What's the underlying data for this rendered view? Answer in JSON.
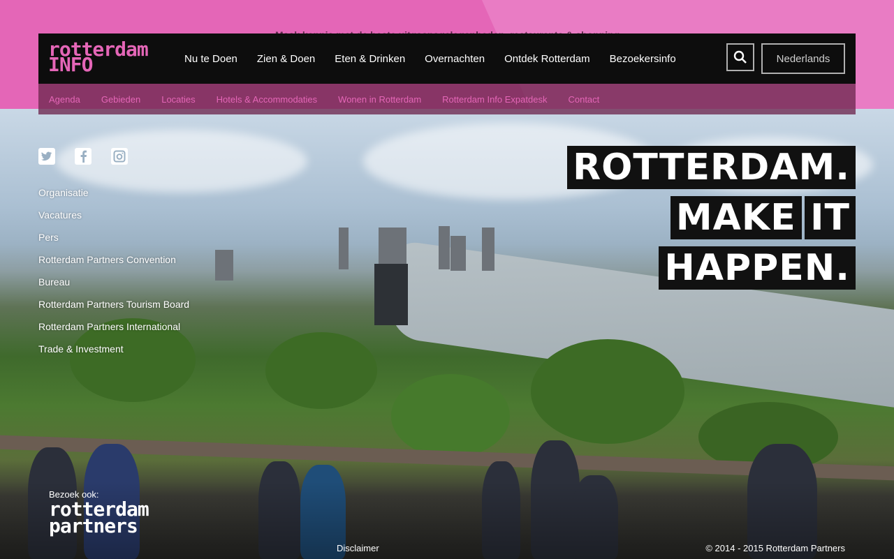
{
  "brand": {
    "line1": "rotterdam",
    "line2": "INFO",
    "color": "#e466b7"
  },
  "ghost_text": "Maak kennis met de beste uitgaansgelegenheden, restaurants & shopping",
  "main_nav": [
    "Nu te Doen",
    "Zien & Doen",
    "Eten & Drinken",
    "Overnachten",
    "Ontdek Rotterdam",
    "Bezoekersinfo"
  ],
  "search": {
    "icon": "search-icon"
  },
  "language": "Nederlands",
  "sub_nav": [
    "Agenda",
    "Gebieden",
    "Locaties",
    "Hotels & Accommodaties",
    "Wonen in Rotterdam",
    "Rotterdam Info Expatdesk",
    "Contact"
  ],
  "social": [
    "twitter-icon",
    "facebook-icon",
    "instagram-icon"
  ],
  "left_links": [
    "Organisatie",
    "Vacatures",
    "Pers",
    "Rotterdam Partners Convention",
    "Bureau",
    "Rotterdam Partners Tourism Board",
    "Rotterdam Partners International",
    "Trade & Investment"
  ],
  "slogan": [
    "ROTTERDAM.",
    "MAKE",
    "IT",
    "HAPPEN."
  ],
  "footer": {
    "visit_label": "Bezoek ook:",
    "partners_line1": "rotterdam",
    "partners_line2": "partners",
    "disclaimer": "Disclaimer",
    "copyright": "© 2014 - 2015 Rotterdam Partners"
  }
}
